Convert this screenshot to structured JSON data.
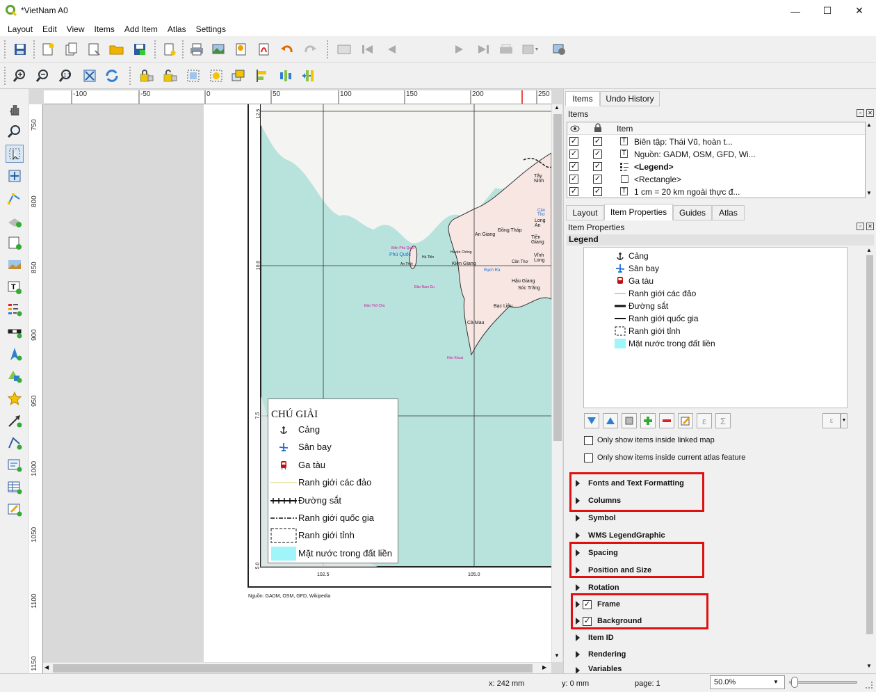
{
  "window": {
    "title": "*VietNam A0",
    "minimize": "—",
    "maximize": "☐",
    "close": "✕"
  },
  "menu": [
    "Layout",
    "Edit",
    "View",
    "Items",
    "Add Item",
    "Atlas",
    "Settings"
  ],
  "toolbar": {
    "page_number": "1"
  },
  "rulers": {
    "horizontal": [
      "-100",
      "-50",
      "0",
      "50",
      "100",
      "150",
      "200",
      "250"
    ],
    "vertical": [
      "750",
      "800",
      "850",
      "900",
      "950",
      "1000",
      "1050",
      "1100",
      "1150"
    ]
  },
  "map": {
    "lat_labels": [
      "12.5",
      "10.0",
      "7.5",
      "5.0"
    ],
    "lon_labels": [
      "102.5",
      "105.0"
    ],
    "place_labels": [
      "Tây Ninh",
      "Long An",
      "Đồng Tháp",
      "An Giang",
      "Tiền Giang",
      "Vĩnh Long",
      "Cần Thơ",
      "Kiên Giang",
      "Rạch Rá",
      "Hậu Giang",
      "Sóc Trăng",
      "Bạc Liêu",
      "Cà Mau",
      "Phú Quốc",
      "An Thới",
      "Hà Tiên",
      "Huyện Chông",
      "Đảo Thổ Chu",
      "Đảo Nam Du",
      "Hòn Khoai",
      "Biển Phú Quốc",
      "Cần Thơ"
    ],
    "source_text": "Nguồn: GADM, OSM, GFD, Wikipedia"
  },
  "map_legend": {
    "title": "CHÚ GIẢI",
    "items": [
      "Cảng",
      "Sân bay",
      "Ga tàu",
      "Ranh giới các đảo",
      "Đường sắt",
      "Ranh giới quốc gia",
      "Ranh giới tỉnh",
      "Mặt nước trong đất liền"
    ]
  },
  "panel": {
    "top_tabs": [
      "Items",
      "Undo History"
    ],
    "items_title": "Items",
    "items_header": "Item",
    "items": [
      "Biên tập: Thái Vũ, hoàn t...",
      "Nguồn: GADM, OSM, GFD, Wi...",
      "<Legend>",
      "<Rectangle>",
      "1 cm = 20 km ngoài thực đ..."
    ],
    "bottom_tabs": [
      "Layout",
      "Item Properties",
      "Guides",
      "Atlas"
    ],
    "props_title": "Item Properties",
    "section": "Legend",
    "legend_tree": [
      "Cảng",
      "Sân bay",
      "Ga tàu",
      "Ranh giới các đảo",
      "Đường sắt",
      "Ranh giới quốc gia",
      "Ranh giới tỉnh",
      "Mặt nước trong đất liền"
    ],
    "opt_linked_map": "Only show items inside linked map",
    "opt_atlas": "Only show items inside current atlas feature",
    "sections": [
      "Fonts and Text Formatting",
      "Columns",
      "Symbol",
      "WMS LegendGraphic",
      "Spacing",
      "Position and Size",
      "Rotation",
      "Frame",
      "Background",
      "Item ID",
      "Rendering",
      "Variables"
    ]
  },
  "status": {
    "x": "x: 242 mm",
    "y": "y: 0 mm",
    "page": "page: 1",
    "zoom": "50.0%"
  },
  "colors": {
    "sea": "#b8e3dc",
    "land": "#f7e6e2",
    "highlight": "#e01010",
    "inland_water": "#9ff5f7"
  }
}
